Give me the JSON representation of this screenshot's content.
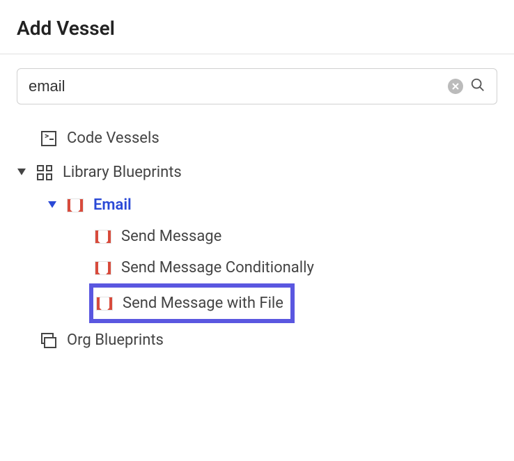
{
  "header": {
    "title": "Add Vessel"
  },
  "search": {
    "value": "email"
  },
  "tree": {
    "code_vessels": "Code Vessels",
    "library_blueprints": "Library Blueprints",
    "email": "Email",
    "send_message": "Send Message",
    "send_message_conditionally": "Send Message Conditionally",
    "send_message_with_file": "Send Message with File",
    "org_blueprints": "Org Blueprints"
  }
}
